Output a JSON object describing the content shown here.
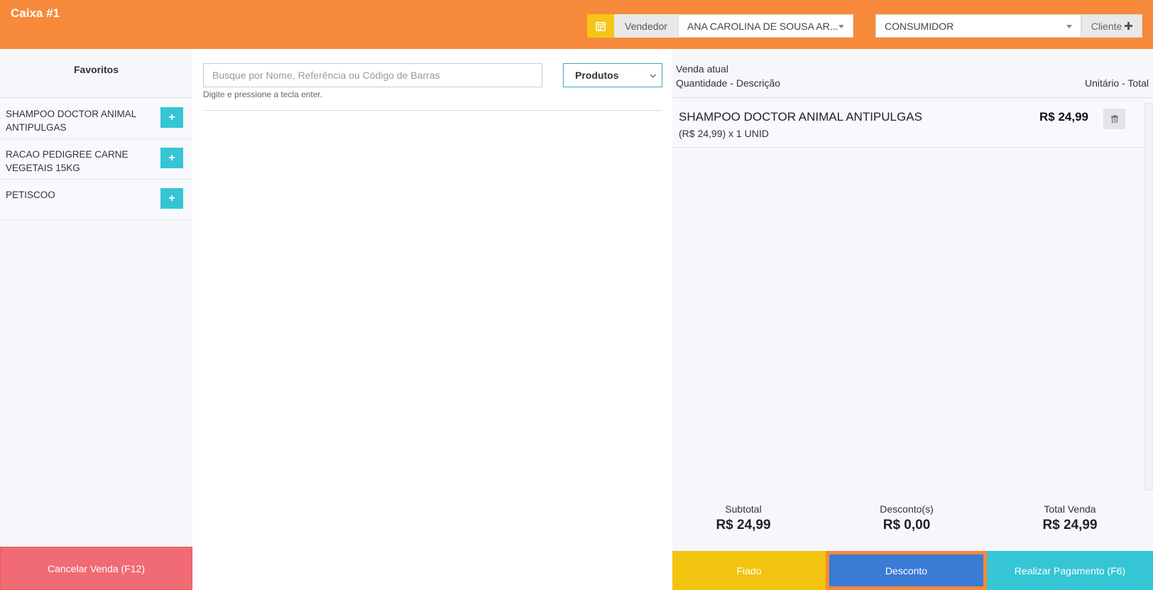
{
  "header": {
    "title": "Caixa #1",
    "vendedor_label": "Vendedor",
    "vendedor_value": "ANA CAROLINA DE SOUSA AR...",
    "cliente_value": "CONSUMIDOR",
    "cliente_button": "Cliente",
    "accent": "#f7893a"
  },
  "favorites": {
    "title": "Favoritos",
    "items": [
      {
        "name": "SHAMPOO DOCTOR ANIMAL ANTIPULGAS"
      },
      {
        "name": "RACAO PEDIGREE CARNE VEGETAIS 15KG"
      },
      {
        "name": "PETISCOO"
      }
    ],
    "add_icon": "+",
    "cancel_label": "Cancelar Venda (F12)"
  },
  "search": {
    "placeholder": "Busque por Nome, Referência ou Código de Barras",
    "hint": "Digite e pressione a tecla enter.",
    "type_selected": "Produtos"
  },
  "sale": {
    "title": "Venda atual",
    "cols_left": "Quantidade - Descrição",
    "cols_right": "Unitário - Total",
    "items": [
      {
        "name": "SHAMPOO DOCTOR ANIMAL ANTIPULGAS",
        "detail": "(R$ 24,99) x 1 UNID",
        "total": "R$ 24,99"
      }
    ],
    "subtotal_label": "Subtotal",
    "subtotal_value": "R$ 24,99",
    "discount_label": "Desconto(s)",
    "discount_value": "R$ 0,00",
    "total_label": "Total Venda",
    "total_value": "R$ 24,99",
    "fiado_label": "Fiado",
    "desconto_label": "Desconto",
    "pay_label": "Realizar Pagamento (F6)"
  }
}
